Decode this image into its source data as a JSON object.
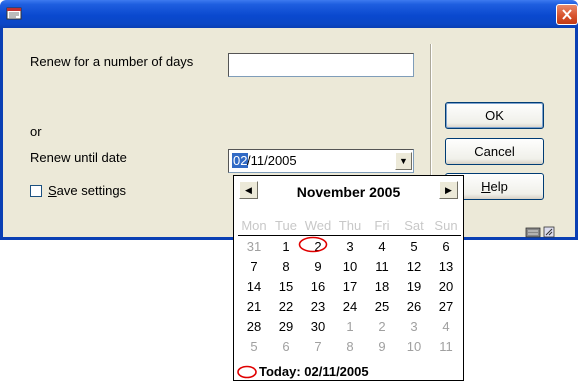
{
  "window": {
    "icon": "app-icon",
    "close_icon": "close-icon",
    "accent": "#0a49cf",
    "face": "#ece9d8"
  },
  "form": {
    "days_label": "Renew for a number of days",
    "days_value": "",
    "or_label": "or",
    "until_label": "Renew until date",
    "date_selected_part": "02",
    "date_rest": "/11/2005",
    "save_prefix": "",
    "save_underlined": "S",
    "save_rest": "ave settings",
    "save_checked": false
  },
  "buttons": {
    "ok": "OK",
    "cancel": "Cancel",
    "help_underlined": "H",
    "help_rest": "elp"
  },
  "calendar": {
    "month_title": "November 2005",
    "prev_icon": "left-arrow-icon",
    "next_icon": "right-arrow-icon",
    "weekdays": [
      "Mon",
      "Tue",
      "Wed",
      "Thu",
      "Fri",
      "Sat",
      "Sun"
    ],
    "weeks": [
      [
        {
          "d": "31",
          "o": true
        },
        {
          "d": "1"
        },
        {
          "d": "2",
          "today": true
        },
        {
          "d": "3"
        },
        {
          "d": "4"
        },
        {
          "d": "5"
        },
        {
          "d": "6"
        }
      ],
      [
        {
          "d": "7"
        },
        {
          "d": "8"
        },
        {
          "d": "9"
        },
        {
          "d": "10"
        },
        {
          "d": "11"
        },
        {
          "d": "12"
        },
        {
          "d": "13"
        }
      ],
      [
        {
          "d": "14"
        },
        {
          "d": "15"
        },
        {
          "d": "16"
        },
        {
          "d": "17"
        },
        {
          "d": "18"
        },
        {
          "d": "19"
        },
        {
          "d": "20"
        }
      ],
      [
        {
          "d": "21"
        },
        {
          "d": "22"
        },
        {
          "d": "23"
        },
        {
          "d": "24"
        },
        {
          "d": "25"
        },
        {
          "d": "26"
        },
        {
          "d": "27"
        }
      ],
      [
        {
          "d": "28"
        },
        {
          "d": "29"
        },
        {
          "d": "30"
        },
        {
          "d": "1",
          "o": true
        },
        {
          "d": "2",
          "o": true
        },
        {
          "d": "3",
          "o": true
        },
        {
          "d": "4",
          "o": true
        }
      ],
      [
        {
          "d": "5",
          "o": true
        },
        {
          "d": "6",
          "o": true
        },
        {
          "d": "7",
          "o": true
        },
        {
          "d": "8",
          "o": true
        },
        {
          "d": "9",
          "o": true
        },
        {
          "d": "10",
          "o": true
        },
        {
          "d": "11",
          "o": true
        }
      ]
    ],
    "today_text": "Today: 02/11/2005",
    "today_marker_color": "#e00000"
  }
}
